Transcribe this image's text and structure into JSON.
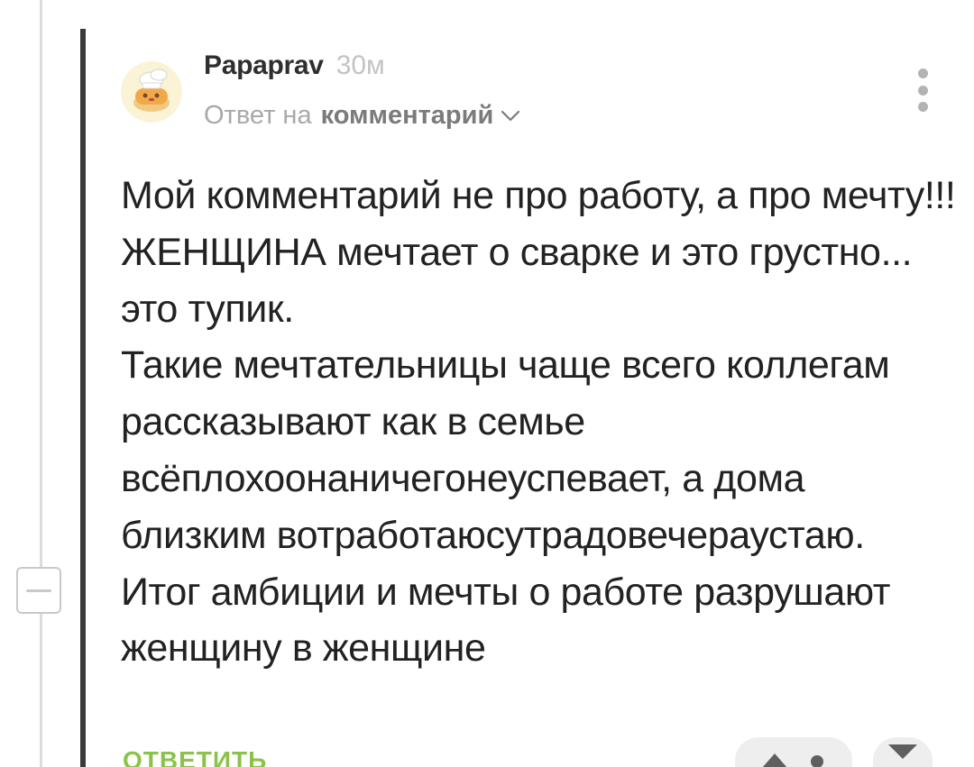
{
  "comment": {
    "author": "Papaprav",
    "time": "30м",
    "reply_prefix": "Ответ на",
    "reply_target": "комментарий",
    "paragraphs": [
      "Мой комментарий не про работу, а про мечту!!!",
      "ЖЕНЩИНА мечтает о сварке и это грустно... это тупик.",
      "Такие мечтательницы чаще всего коллегам рассказывают как в семье всёплохоонаничегонеуспевает, а дома близким вотработаюсутрадовечераустаю.",
      "Итог амбиции и мечты о работе разрушают женщину в женщине"
    ],
    "reply_label": "ОТВЕТИТЬ"
  },
  "icons": {
    "menu": "more-vertical-icon",
    "collapse": "minus-icon",
    "chevron": "chevron-down-icon",
    "vote_up": "arrow-up-icon",
    "vote_down": "arrow-down-icon"
  },
  "colors": {
    "reply_link": "#8bc34a",
    "thread_line": "#3a3a3a",
    "muted_text": "#a9a9a9"
  }
}
